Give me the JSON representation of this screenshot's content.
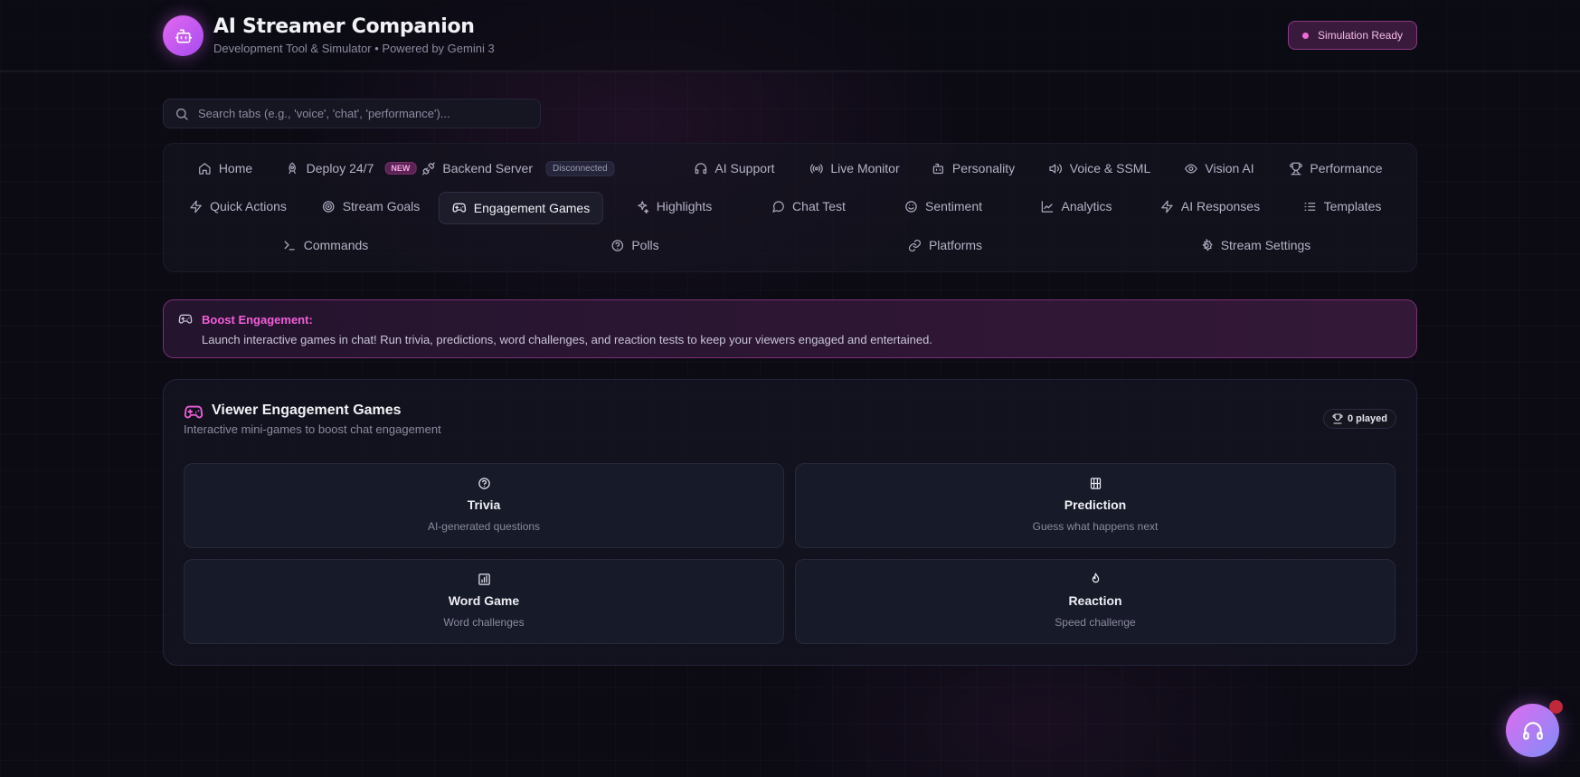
{
  "header": {
    "title": "AI Streamer Companion",
    "subtitle": "Development Tool & Simulator • Powered by Gemini 3",
    "status": "Simulation Ready"
  },
  "search": {
    "placeholder": "Search tabs (e.g., 'voice', 'chat', 'performance')..."
  },
  "tabs": {
    "home": "Home",
    "deploy": "Deploy 24/7",
    "deploy_badge": "NEW",
    "backend": "Backend Server",
    "backend_badge": "Disconnected",
    "ai_support": "AI Support",
    "live_monitor": "Live Monitor",
    "personality": "Personality",
    "voice": "Voice & SSML",
    "vision": "Vision AI",
    "performance": "Performance",
    "quick_actions": "Quick Actions",
    "stream_goals": "Stream Goals",
    "engagement_games": "Engagement Games",
    "highlights": "Highlights",
    "chat_test": "Chat Test",
    "sentiment": "Sentiment",
    "analytics": "Analytics",
    "ai_responses": "AI Responses",
    "templates": "Templates",
    "commands": "Commands",
    "polls": "Polls",
    "platforms": "Platforms",
    "stream_settings": "Stream Settings",
    "active": "Engagement Games"
  },
  "banner": {
    "title": "Boost Engagement:",
    "text": "Launch interactive games in chat! Run trivia, predictions, word challenges, and reaction tests to keep your viewers engaged and entertained."
  },
  "games": {
    "title": "Viewer Engagement Games",
    "subtitle": "Interactive mini-games to boost chat engagement",
    "played": "0 played",
    "items": [
      {
        "name": "Trivia",
        "desc": "AI-generated questions",
        "icon": "question-icon"
      },
      {
        "name": "Prediction",
        "desc": "Guess what happens next",
        "icon": "grid-icon"
      },
      {
        "name": "Word Game",
        "desc": "Word challenges",
        "icon": "bar-chart-icon"
      },
      {
        "name": "Reaction",
        "desc": "Speed challenge",
        "icon": "flame-icon"
      }
    ]
  },
  "colors": {
    "accent": "#f15ed7",
    "background": "#0c0b14",
    "badge_border": "#8a3a82"
  }
}
